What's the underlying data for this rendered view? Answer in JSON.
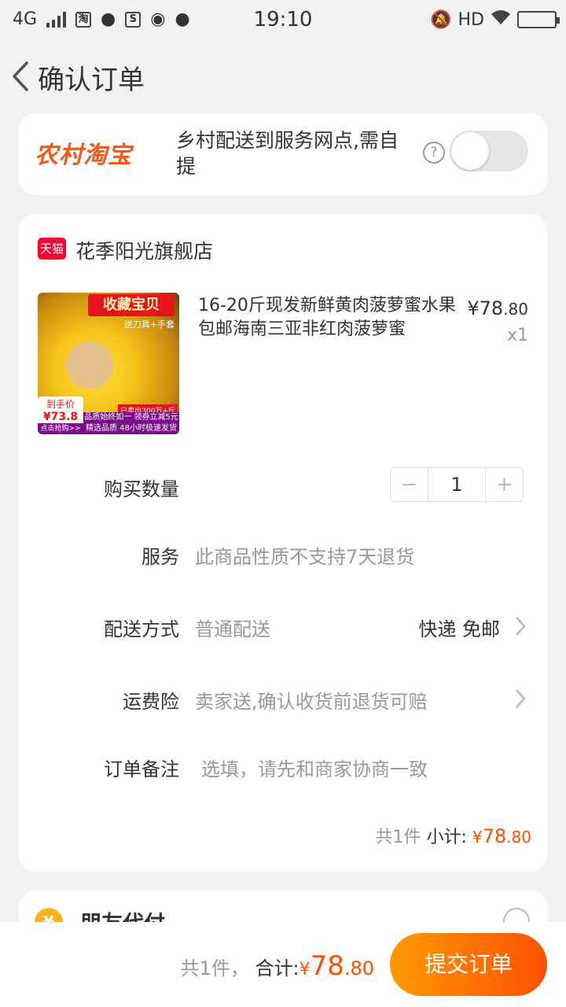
{
  "status_bar": {
    "network": "4G",
    "time": "19:10",
    "hd": "HD",
    "app_icons": [
      "taobao-icon",
      "qq-icon",
      "s-app-icon",
      "wechat-icon",
      "message-icon"
    ]
  },
  "header": {
    "title": "确认订单"
  },
  "rural": {
    "logo": "农村淘宝",
    "text": "乡村配送到服务网点,需自提",
    "help": "?",
    "toggle_on": false
  },
  "order": {
    "tmall_badge": "天猫",
    "shop_name": "花季阳光旗舰店",
    "product": {
      "title": "16-20斤现发新鲜黄肉菠萝蜜水果包邮海南三亚非红肉菠萝蜜",
      "price_symbol": "¥",
      "price_int": "78",
      "price_dec": ".80",
      "qty": "x1",
      "image": {
        "banner": "收藏宝贝",
        "sub": "送刀具+手套",
        "price_label": "到手价",
        "price": "¥73.8元",
        "cta": "点击抢购>>",
        "promo": "品质始终如一 领券立减5元",
        "promo2": "精选品质  48小时极速发货",
        "sold": "已卖出300万+斤"
      }
    },
    "quantity": {
      "label": "购买数量",
      "minus": "−",
      "value": "1",
      "plus": "+"
    },
    "service": {
      "label": "服务",
      "value": "此商品性质不支持7天退货"
    },
    "delivery": {
      "label": "配送方式",
      "value": "普通配送",
      "right": "快递 免邮"
    },
    "insurance": {
      "label": "运费险",
      "value": "卖家送,确认收货前退货可赔"
    },
    "remark": {
      "label": "订单备注",
      "placeholder": "选填，请先和商家协商一致"
    },
    "subtotal": {
      "count": "共1件",
      "label": "小计:",
      "amount_yen": "¥",
      "amount_int": "78",
      "amount_dec": ".80"
    }
  },
  "friend_pay": {
    "icon": "¥",
    "label": "朋友代付"
  },
  "bottom": {
    "count": "共1件，",
    "total_label": "合计:",
    "yen": "¥",
    "int": "78",
    "dec": ".80",
    "submit": "提交订单"
  },
  "colors": {
    "accent": "#ff5000",
    "tmall": "#ff0036",
    "rural_logo": "#f05a1a"
  }
}
